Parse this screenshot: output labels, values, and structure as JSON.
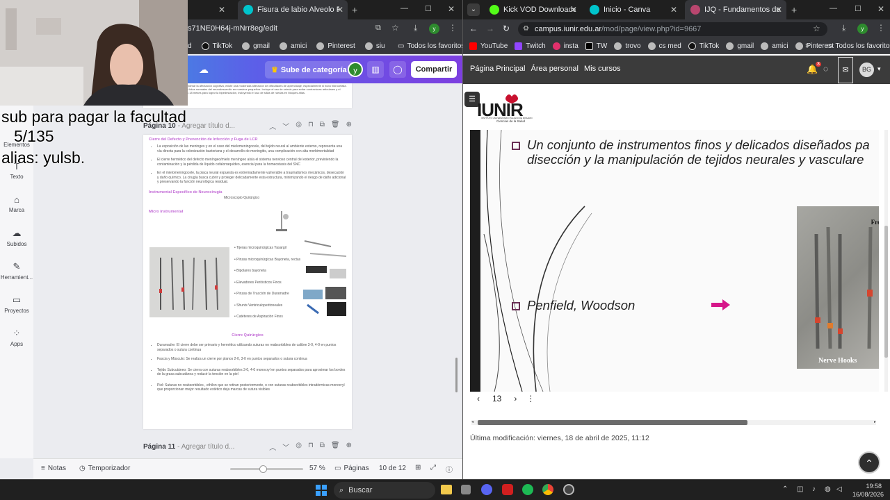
{
  "left_window": {
    "tabs": [
      {
        "label": "Fisura de labio Alveolo Palatino",
        "active": true
      }
    ],
    "address": "s71NE0H64j-mNrr8eg/edit",
    "bookmarks": [
      "d",
      "TikTok",
      "gmail",
      "amici",
      "Pinterest",
      "siu",
      "Todos los favoritos"
    ],
    "canva_topbar": {
      "upgrade_label": "Sube de categoría",
      "avatar_letter": "y",
      "share_label": "Compartir"
    },
    "sidebar": [
      {
        "label": "Elementos",
        "icon": "shapes-icon"
      },
      {
        "label": "Texto",
        "icon": "text-icon"
      },
      {
        "label": "Marca",
        "icon": "brand-icon"
      },
      {
        "label": "Subidos",
        "icon": "upload-icon"
      },
      {
        "label": "Herramient...",
        "icon": "tools-icon"
      },
      {
        "label": "Proyectos",
        "icon": "folder-icon"
      },
      {
        "label": "Apps",
        "icon": "apps-icon"
      }
    ],
    "page10": {
      "label": "Página 10",
      "title_placeholder": "- Agregar título d...",
      "h_cierre": "Cierre del Defecto y Prevención de Infección y Fuga de LCR",
      "p1": "La exposición de las meninges y en el caso del mielomeningocele, del tejido neural al ambiente externo, representa una vía directa para la colonización bacteriana y el desarrollo de meningitis, una complicación con alta morbimortalidad",
      "p2": "El cierre hermético del defecto meníngeo/mielo meníngeo aísla el sistema nervioso central del exterior, previniendo la contaminación y la pérdida de líquido cefalorraquídeo, esencial para la homeostasis del SNC",
      "p3": "En el mielomeningocele, la placa neural expuesta es extremadamente vulnerable a traumatismos mecánicos, desecación y daño químico. La cirugía busca cubrir y proteger delicadamente esta estructura, minimizando el riesgo de daño adicional y preservando la función neurológica residual.",
      "h_instr": "Instrumental Específico de Neurocirugía",
      "microscopio": "Microscopio Quirúrgico",
      "h_micro": "Micro instrumental",
      "instruments": [
        "Tijeras microquirúrgicas Yasargil",
        "Pinzas microquirúrgicas  Bayoneta, rectas",
        "Bipolares bayoneta",
        "Elevadores Periósticos Finos",
        "Pinzas de Tracción de Duramadre",
        "Shunts Ventriculoperitoneales",
        "Catéteres de Aspiración Finos"
      ],
      "h_cierre_q": "Cierre Quirúrgico",
      "closure": [
        "Duramadre: El cierre debe ser primario y hermético utilizando suturas no reabsorbibles de calibre 3-0, 4-0 en puntos separados o sutura continua",
        "Fascia y Músculo: Se realiza un cierre por planos 2-0, 3-0 en puntos separados o sutura continua",
        "Tejido Subcutáneo:  Se cierra con suturas reabsorbibles 3-0, 4-0 monocryl en puntos separados para aproximar los bordes de la grasa subcutánea y reducir la tensión en la piel",
        "Piel: Suturas no reabsorbibles , ethilon que se retiran posteriormente, o con suturas reabsorbibles intradérmicas monocryl que proporcionan mejor resultado estético  deja marcas de sutura visibles"
      ],
      "top_snippet": "Se hace gran énfasis en no subestimar la afectación cognitiva, existe una moderada alteración de dificultades de aprendizaje, especialmente si hubo hidrocefalia. La estimulación busca emular los hitos normales del neurodesarrollo en nuestros pequeños. Incluye el uso de ortesis para evitar contracturas articulares y el entrenamiento postural desde los 18 meses para lograr la bipedestación, incluyendo el uso de sillas de ruedas en bloques altas."
    },
    "page11": {
      "label": "Página 11",
      "title_placeholder": "- Agregar título d..."
    },
    "bottom": {
      "notes": "Notas",
      "timer": "Temporizador",
      "zoom": "57 %",
      "pages_label": "Páginas",
      "page_count": "10 de 12"
    }
  },
  "overlay": {
    "line1": "sub para pagar la facultad",
    "line2": "5/135",
    "line3": "alias: yulsb."
  },
  "right_window": {
    "tabs": [
      {
        "label": "Kick VOD Downloader - Stre"
      },
      {
        "label": "Inicio - Canva"
      },
      {
        "label": "IJQ - Fundamentos de la Ins",
        "active": true
      }
    ],
    "address_domain": "campus.iunir.edu.ar",
    "address_path": "/mod/page/view.php?id=9667",
    "bookmarks": [
      "YouTube",
      "Twitch",
      "insta",
      "TW",
      "trovo",
      "cs med",
      "TikTok",
      "gmail",
      "amici",
      "Pinterest",
      "Todos los favoritos"
    ],
    "nav": {
      "items": [
        "Página Principal",
        "Área personal",
        "Mis cursos"
      ],
      "notif_count": "3",
      "user_initials": "BG"
    },
    "logo": {
      "name": "IUNIR",
      "subtitle": "INSTITUTO UNIVERSITARIO ITALIANO DE ROSARIO",
      "tag": "Ciencias de la Salud"
    },
    "slide": {
      "bullet1_line1": "Un conjunto de instrumentos finos y delicados diseñados pa",
      "bullet1_line2": "disección y la manipulación de tejidos neurales y vasculare",
      "bullet2": "Penfield, Woodson",
      "photo_label_top": "Freer",
      "photo_label_bottom": "Nerve Hooks"
    },
    "pager": {
      "page": "13"
    },
    "last_modified": "Última modificación: viernes, 18 de abril de 2025, 11:12"
  },
  "taskbar": {
    "search": "Buscar",
    "time": "19:58",
    "date": "16/08/2026"
  },
  "colors": {
    "canva_gradient_start": "#1ec2d6",
    "canva_gradient_end": "#7d3fe0",
    "doc_heading": "#c26bd6",
    "moodle_nav": "#3b3b3b",
    "slide_arrow": "#d6178a",
    "upgrade_button": "#5a46d6"
  }
}
